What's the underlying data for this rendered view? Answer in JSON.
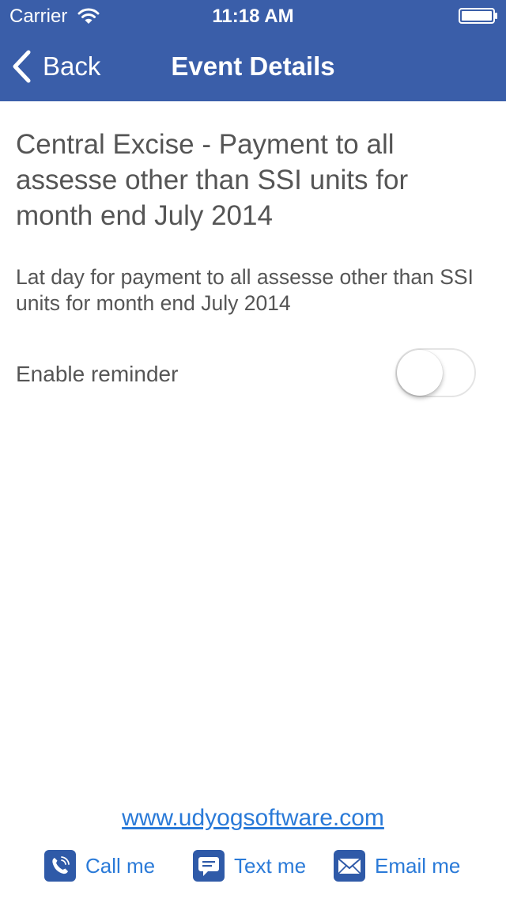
{
  "status_bar": {
    "carrier": "Carrier",
    "time": "11:18 AM",
    "wifi_icon": "wifi-icon",
    "battery_icon": "battery-icon"
  },
  "nav": {
    "back_label": "Back",
    "title": "Event Details"
  },
  "event": {
    "title": "Central Excise - Payment to all assesse other than SSI units for month end July 2014",
    "description": "Lat day for payment to all assesse other than SSI units for month end July 2014"
  },
  "reminder": {
    "label": "Enable reminder",
    "enabled": false
  },
  "footer": {
    "website": "www.udyogsoftware.com",
    "actions": [
      {
        "label": "Call me",
        "icon": "phone-icon"
      },
      {
        "label": "Text me",
        "icon": "chat-bubble-icon"
      },
      {
        "label": "Email me",
        "icon": "envelope-icon"
      }
    ]
  },
  "colors": {
    "header_bg": "#3a5ea9",
    "link": "#2a7ad8",
    "body_text": "#555555",
    "icon_bg": "#2f5aa8"
  }
}
